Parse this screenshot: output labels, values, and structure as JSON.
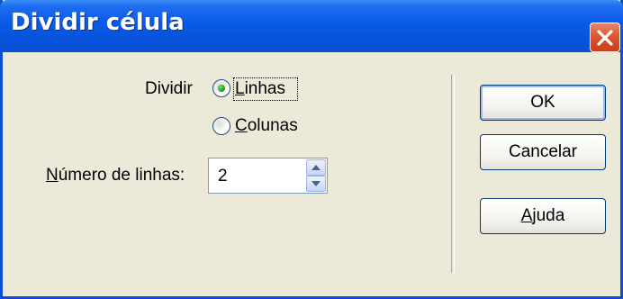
{
  "window": {
    "title": "Dividir célula"
  },
  "form": {
    "dividir_label": "Dividir",
    "radios": [
      {
        "label_first": "L",
        "label_rest": "inhas",
        "selected": true
      },
      {
        "label_first": "C",
        "label_rest": "olunas",
        "selected": false
      }
    ],
    "numero_label_first": "N",
    "numero_label_rest": "úmero de linhas:",
    "numero_value": "2"
  },
  "buttons": {
    "ok": "OK",
    "cancelar": "Cancelar",
    "ajuda_first": "A",
    "ajuda_rest": "juda"
  },
  "colors": {
    "titlebar": "#0a4fd6",
    "dialog_bg": "#ece9d8",
    "close": "#d9532f",
    "radio_dot": "#21a121"
  },
  "icons": [
    "close-icon",
    "arrow-up-icon",
    "arrow-down-icon"
  ]
}
